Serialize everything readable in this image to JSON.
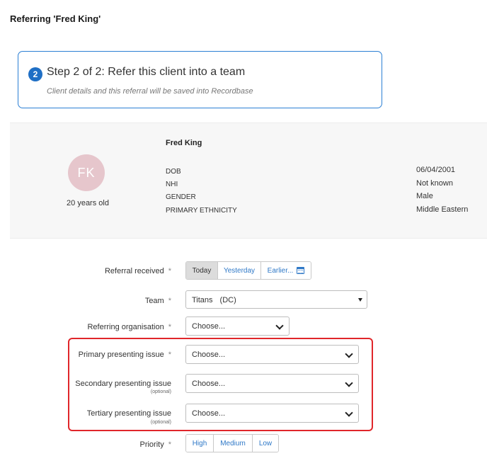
{
  "page": {
    "title": "Referring 'Fred King'"
  },
  "step": {
    "number": "2",
    "title": "Step 2 of 2: Refer this client into a team",
    "subtitle": "Client details and this referral will be saved into Recordbase"
  },
  "client": {
    "initials": "FK",
    "age": "20 years old",
    "name": "Fred King",
    "details": [
      {
        "label": "DOB",
        "value": "06/04/2001"
      },
      {
        "label": "NHI",
        "value": "Not known"
      },
      {
        "label": "GENDER",
        "value": "Male"
      },
      {
        "label": "PRIMARY ETHNICITY",
        "value": "Middle Eastern"
      }
    ]
  },
  "form": {
    "required_marker": "*",
    "optional_text": "(optional)",
    "referral_received": {
      "label": "Referral received",
      "options": [
        "Today",
        "Yesterday",
        "Earlier..."
      ],
      "selected": "Today"
    },
    "team": {
      "label": "Team",
      "value": "Titans",
      "code": "(DC)"
    },
    "referring_org": {
      "label": "Referring organisation",
      "value": "Choose..."
    },
    "primary_issue": {
      "label": "Primary presenting issue",
      "value": "Choose..."
    },
    "secondary_issue": {
      "label": "Secondary presenting issue",
      "value": "Choose..."
    },
    "tertiary_issue": {
      "label": "Tertiary presenting issue",
      "value": "Choose..."
    },
    "priority": {
      "label": "Priority",
      "options": [
        "High",
        "Medium",
        "Low"
      ]
    }
  },
  "colors": {
    "accent": "#1f6fc5",
    "link": "#2e78c7",
    "highlight": "#e0262a",
    "avatar": "#e6c6cc"
  },
  "icons": {
    "calendar": "calendar-icon",
    "dropdown": "chevron-down-icon"
  }
}
